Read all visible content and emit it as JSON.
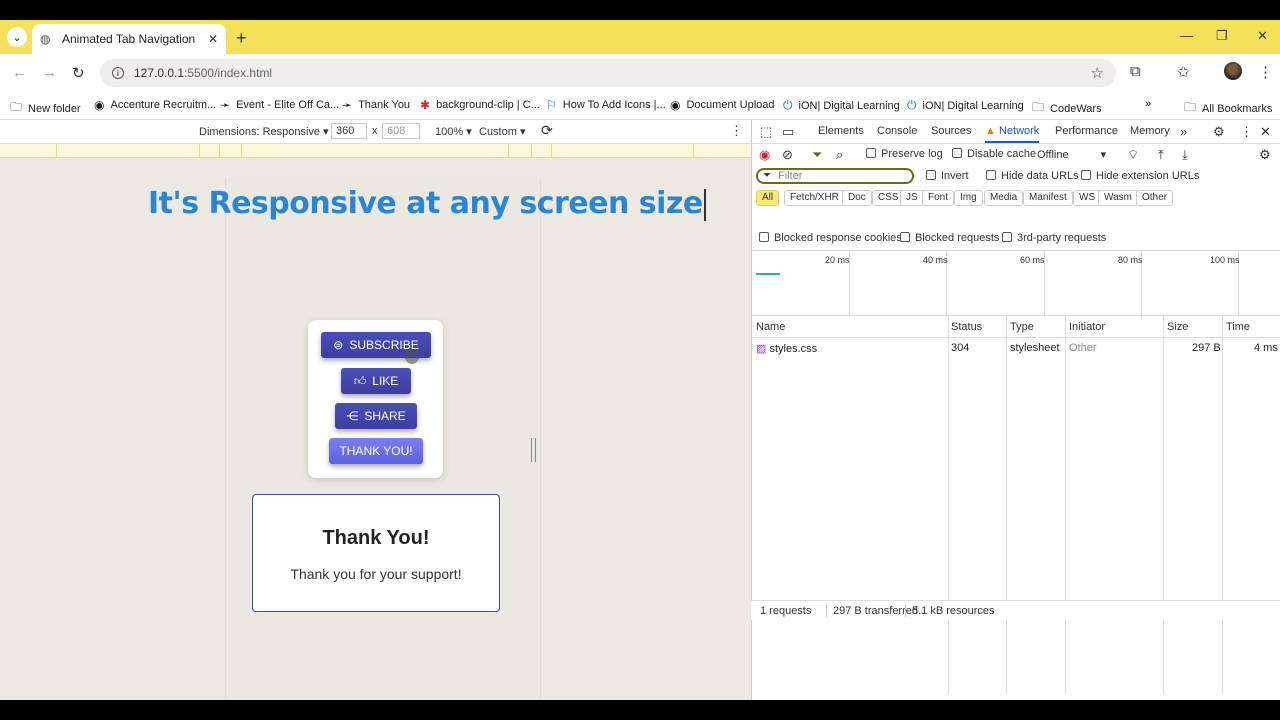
{
  "browser": {
    "tab_title": "Animated Tab Navigation",
    "url_host": "127.0.0.1",
    "url_rest": ":5500/index.html"
  },
  "bookmarks": [
    {
      "label": "New folder",
      "icon": "folder-icon"
    },
    {
      "label": "Accenture Recruitm...",
      "icon": "globe-icon"
    },
    {
      "label": "Event - Elite Off Ca...",
      "icon": "arrow-icon"
    },
    {
      "label": "Thank You",
      "icon": "arrow-icon"
    },
    {
      "label": "background-clip | C...",
      "icon": "asterisk-icon"
    },
    {
      "label": "How To Add Icons |...",
      "icon": "flag-icon"
    },
    {
      "label": "Document Upload",
      "icon": "globe-icon"
    },
    {
      "label": "iON| Digital Learning",
      "icon": "power-icon"
    },
    {
      "label": "iON| Digital Learning",
      "icon": "power-icon"
    },
    {
      "label": "CodeWars",
      "icon": "folder-icon"
    }
  ],
  "all_bookmarks": "All Bookmarks",
  "device_toolbar": {
    "dimensions": "Dimensions: Responsive",
    "width": "360",
    "x": "x",
    "height": "608",
    "zoom": "100%",
    "throttle": "Custom"
  },
  "page": {
    "heading": "It's Responsive at any screen size",
    "buttons": [
      "SUBSCRIBE",
      "LIKE",
      "SHARE",
      "THANK YOU!"
    ],
    "thank_title": "Thank You!",
    "thank_text": "Thank you for your support!"
  },
  "devtools": {
    "tabs": [
      "Elements",
      "Console",
      "Sources",
      "Network",
      "Performance",
      "Memory"
    ],
    "active_tab": "Network",
    "preserve_log": "Preserve log",
    "disable_cache": "Disable cache",
    "throttling": "Offline",
    "filter_placeholder": "Filter",
    "invert": "Invert",
    "hide_data_urls": "Hide data URLs",
    "hide_extension_urls": "Hide extension URLs",
    "type_filters": [
      "All",
      "Fetch/XHR",
      "Doc",
      "CSS",
      "JS",
      "Font",
      "Img",
      "Media",
      "Manifest",
      "WS",
      "Wasm",
      "Other"
    ],
    "blocked_response_cookies": "Blocked response cookies",
    "blocked_requests": "Blocked requests",
    "third_party_requests": "3rd-party requests",
    "timeline_labels": [
      "20 ms",
      "40 ms",
      "60 ms",
      "80 ms",
      "100 ms"
    ],
    "columns": [
      "Name",
      "Status",
      "Type",
      "Initiator",
      "Size",
      "Time"
    ],
    "rows": [
      {
        "name": "styles.css",
        "status": "304",
        "type": "stylesheet",
        "initiator": "Other",
        "size": "297 B",
        "time": "4 ms"
      }
    ],
    "status": {
      "requests": "1 requests",
      "transferred": "297 B transferred",
      "resources": "5.1 kB resources"
    }
  }
}
